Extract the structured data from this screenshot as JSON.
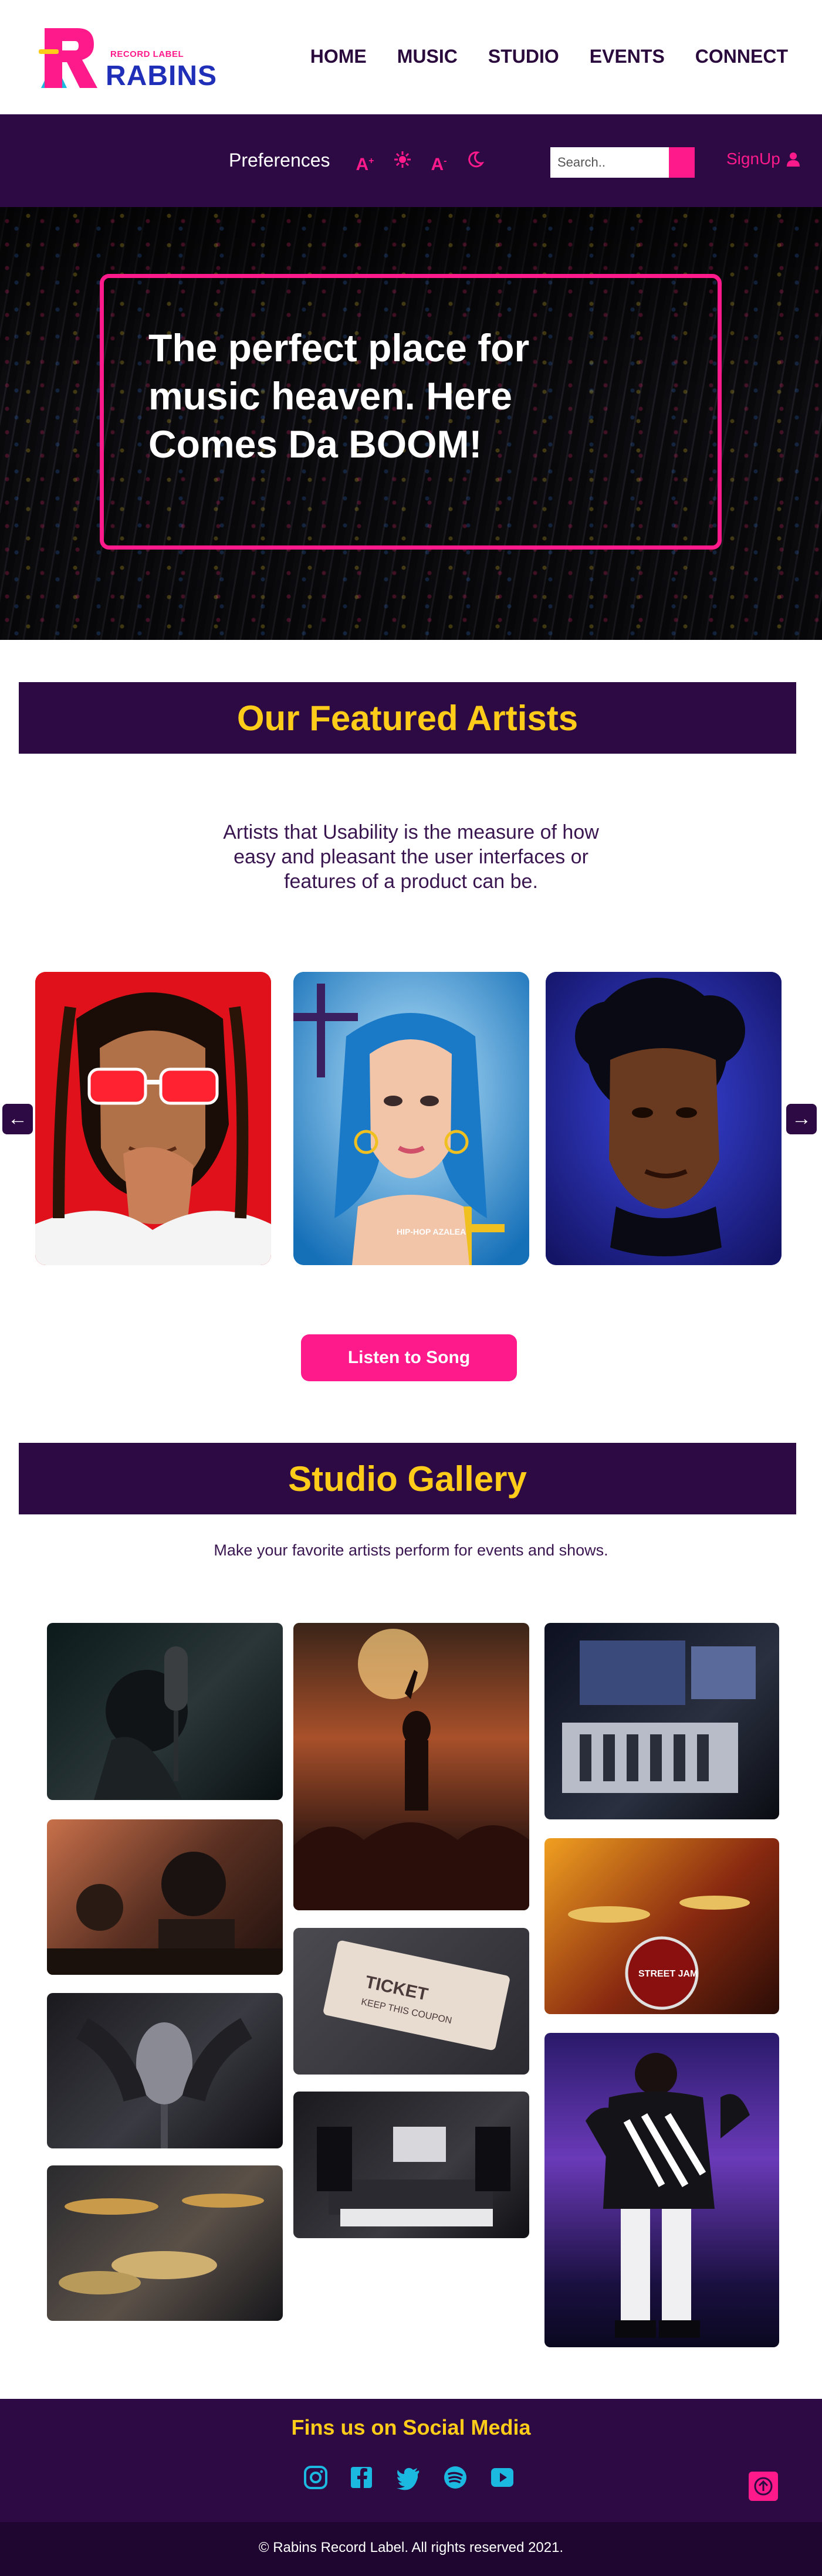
{
  "brand": {
    "logo_small": "RECORD LABEL",
    "logo_big": "RABINS"
  },
  "nav": {
    "items": [
      "HOME",
      "MUSIC",
      "STUDIO",
      "EVENTS",
      "CONNECT"
    ]
  },
  "preferences": {
    "label": "Preferences",
    "icons": [
      "font-increase-icon",
      "contrast-icon",
      "font-decrease-icon",
      "dark-mode-icon"
    ],
    "search_placeholder": "Search..",
    "signup_label": "SignUp"
  },
  "hero": {
    "headline": "The perfect place for music heaven. Here Comes Da BOOM!"
  },
  "featured": {
    "title": "Our Featured Artists",
    "description": "Artists that Usability is the measure of how easy and pleasant the user interfaces or features of a product can be.",
    "card_caption": "HIP-HOP AZALEA",
    "listen_label": "Listen to Song"
  },
  "gallery": {
    "title": "Studio Gallery",
    "description": "Make your favorite artists perform for events and shows.",
    "ticket_text": "TICKET",
    "ticket_small": "KEEP THIS COUPON",
    "drum_text": "STREET JAM"
  },
  "footer": {
    "title": "Fins us on Social Media",
    "social": [
      "instagram-icon",
      "facebook-icon",
      "twitter-icon",
      "spotify-icon",
      "youtube-icon"
    ],
    "copyright": "© Rabins Record Label. All rights reserved 2021."
  },
  "colors": {
    "primary": "#2e0a45",
    "accent": "#ff1a8c",
    "highlight": "#ffcc1a",
    "social": "#1bb8e0"
  }
}
